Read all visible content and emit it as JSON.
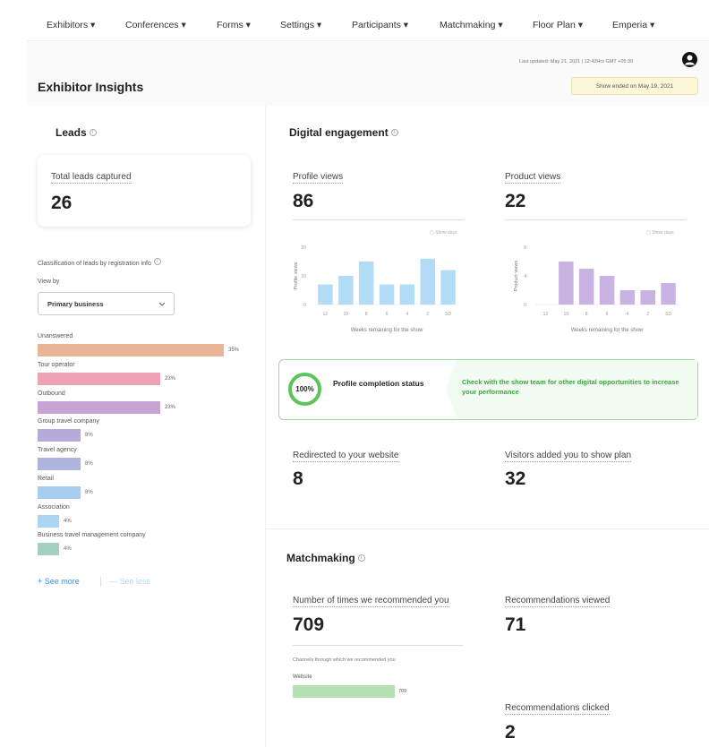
{
  "nav": {
    "items": [
      {
        "label": "Exhibitors ▾"
      },
      {
        "label": "Conferences ▾"
      },
      {
        "label": "Forms ▾"
      },
      {
        "label": "Settings ▾"
      },
      {
        "label": "Participants ▾"
      },
      {
        "label": "Matchmaking ▾"
      },
      {
        "label": "Floor Plan ▾"
      },
      {
        "label": "Emperia ▾"
      }
    ]
  },
  "header": {
    "title": "Exhibitor Insights",
    "last_updated": "Last updated: May 21, 2021 | 12:42Hrs GMT +05:30",
    "show_status": "Show ended on May 19, 2021",
    "avatar_icon": "user-icon"
  },
  "leads": {
    "title": "Leads",
    "total_label": "Total leads captured",
    "total_value": "26",
    "classification_label": "Classification of leads by registration info",
    "view_by_label": "View by",
    "view_by_value": "Primary business",
    "see_more": "+ See more",
    "see_less": "— See less",
    "bars": [
      {
        "label": "Unanswered",
        "value": 35,
        "pct": "35%",
        "color": "#e8b596"
      },
      {
        "label": "Tour operator",
        "value": 23,
        "pct": "23%",
        "color": "#eea2b6"
      },
      {
        "label": "Outbound",
        "value": 23,
        "pct": "23%",
        "color": "#c7a3d6"
      },
      {
        "label": "Group travel company",
        "value": 8,
        "pct": "8%",
        "color": "#b5aad8"
      },
      {
        "label": "Travel agency",
        "value": 8,
        "pct": "8%",
        "color": "#aeb3df"
      },
      {
        "label": "Retail",
        "value": 8,
        "pct": "8%",
        "color": "#a9cdf0"
      },
      {
        "label": "Association",
        "value": 4,
        "pct": "4%",
        "color": "#a9d4f2"
      },
      {
        "label": "Business travel management company",
        "value": 4,
        "pct": "4%",
        "color": "#a4cfc2"
      }
    ]
  },
  "digital": {
    "title": "Digital engagement",
    "profile_views_label": "Profile views",
    "profile_views_value": "86",
    "product_views_label": "Product views",
    "product_views_value": "22",
    "show_days": "Show days",
    "profile_completion_pct": "100%",
    "profile_completion_label": "Profile completion status",
    "profile_completion_note": "Check with the show team for other digital opportunities to increase your performance",
    "redirected_label": "Redirected to your website",
    "redirected_value": "8",
    "visitors_added_label": "Visitors added you to show plan",
    "visitors_added_value": "32"
  },
  "matchmaking": {
    "title": "Matchmaking",
    "recommended_label": "Number of times we recommended you",
    "recommended_value": "709",
    "viewed_label": "Recommendations viewed",
    "viewed_value": "71",
    "clicked_label": "Recommendations clicked",
    "clicked_value": "2",
    "channels_label": "Channels through which we recommended you",
    "channel": {
      "label": "Website",
      "value": 709,
      "value_text": "709",
      "color": "#b4e0b4"
    }
  },
  "chart_data": [
    {
      "type": "bar",
      "ylabel": "Profile views",
      "xlabel": "Weeks remaining for the show",
      "categories": [
        "12",
        "10",
        "8",
        "6",
        "4",
        "2",
        "SD"
      ],
      "values": [
        7,
        10,
        15,
        7,
        7,
        16,
        12
      ],
      "ylim": [
        0,
        20
      ],
      "yticks": [
        "0",
        "10",
        "20"
      ],
      "color": "#b3dcf7"
    },
    {
      "type": "bar",
      "ylabel": "Product views",
      "xlabel": "Weeks remaining for the show",
      "categories": [
        "12",
        "10",
        "8",
        "6",
        "4",
        "2",
        "SD"
      ],
      "values": [
        0,
        6,
        5,
        4,
        2,
        2,
        3
      ],
      "ylim": [
        0,
        8
      ],
      "yticks": [
        "0",
        "4",
        "8"
      ],
      "color": "#c9b3e3"
    }
  ]
}
